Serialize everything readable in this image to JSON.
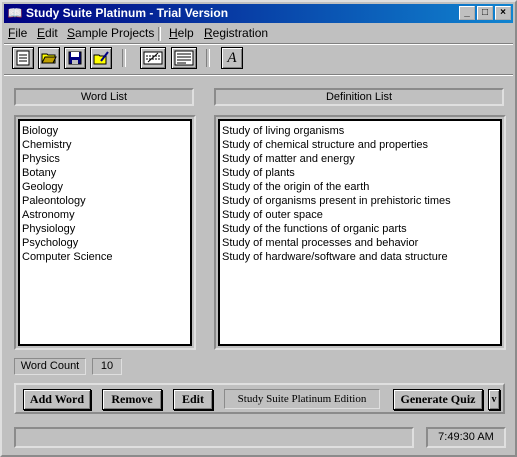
{
  "window": {
    "title": "Study Suite Platinum - Trial Version"
  },
  "menu": [
    {
      "label": "File",
      "u": "F",
      "rest": "ile"
    },
    {
      "label": "Edit",
      "u": "E",
      "rest": "dit"
    },
    {
      "label": "Sample Projects",
      "u": "S",
      "rest": "ample Projects"
    },
    {
      "label": "Help",
      "u": "H",
      "rest": "elp"
    },
    {
      "label": "Registration",
      "u": "R",
      "rest": "egistration"
    }
  ],
  "toolbar": {
    "icons": [
      "new-document-icon",
      "open-folder-icon",
      "save-disk-icon",
      "edit-folder-icon",
      "keyboard-entry-icon",
      "print-preview-icon",
      "font-icon"
    ],
    "font_glyph": "A"
  },
  "word_list": {
    "header": "Word List",
    "items": [
      "Biology",
      "Chemistry",
      "Physics",
      "Botany",
      "Geology",
      "Paleontology",
      "Astronomy",
      "Physiology",
      "Psychology",
      "Computer Science"
    ]
  },
  "definition_list": {
    "header": "Definition List",
    "items": [
      "Study of living organisms",
      "Study of chemical structure and properties",
      "Study of matter and energy",
      "Study of plants",
      "Study of the origin of the earth",
      "Study of organisms present in prehistoric times",
      "Study of outer space",
      "Study of the functions of organic parts",
      "Study of mental processes and behavior",
      "Study of hardware/software and data structure"
    ]
  },
  "word_count": {
    "label": "Word Count",
    "value": "10"
  },
  "buttons": {
    "add_word": "Add Word",
    "remove": "Remove",
    "edit": "Edit",
    "edition": "Study Suite Platinum Edition",
    "generate_quiz": "Generate Quiz",
    "dropdown": "v"
  },
  "status": {
    "message": "",
    "time": "7:49:30 AM"
  }
}
